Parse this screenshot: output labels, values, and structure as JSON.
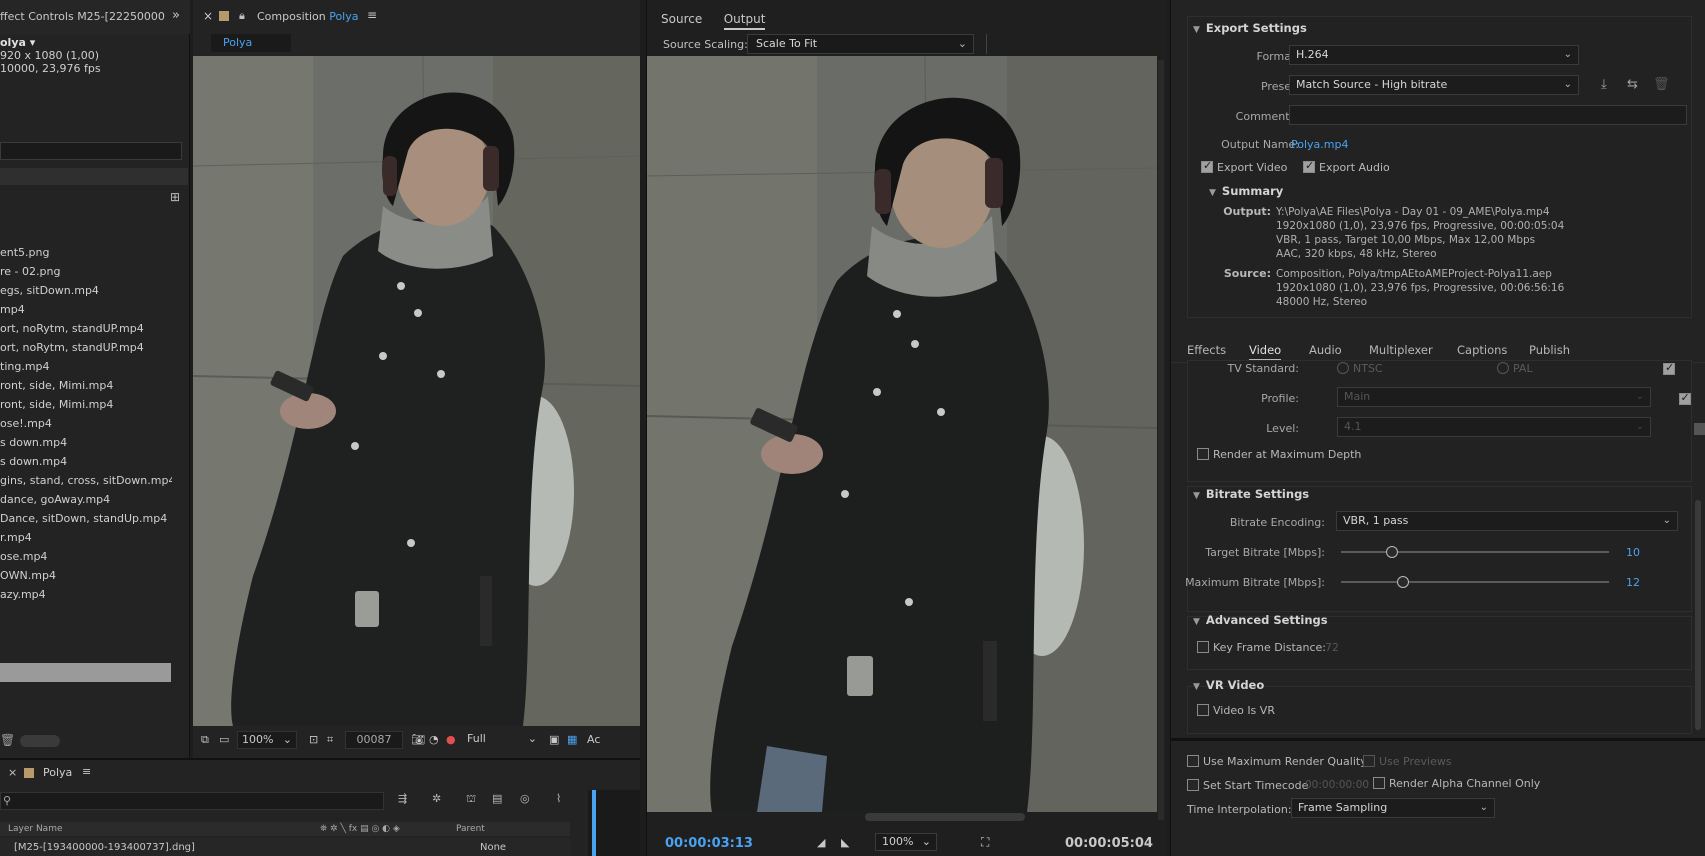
{
  "project": {
    "tab_title": "ffect Controls M25-[22250000",
    "comp_name": "olya ▾",
    "comp_res": "920 x 1080 (1,00)",
    "comp_frames": "10000, 23,976 fps",
    "files": [
      "ent5.png",
      "re - 02.png",
      "egs, sitDown.mp4",
      "mp4",
      "ort, noRytm, standUP.mp4",
      "ort, noRytm, standUP.mp4",
      "ting.mp4",
      "ront, side, Mimi.mp4",
      "ront, side, Mimi.mp4",
      "ose!.mp4",
      "s down.mp4",
      "s down.mp4",
      "gins, stand, cross, sitDown.mp4",
      "dance, goAway.mp4",
      "Dance, sitDown, standUp.mp4",
      "r.mp4",
      "ose.mp4",
      "OWN.mp4",
      "azy.mp4"
    ]
  },
  "composition": {
    "tab_prefix": "Composition",
    "tab_name": "Polya",
    "subtab": "Polya",
    "zoom": "100%",
    "frame": "00087",
    "resolution": "Full",
    "trailing": "Ac"
  },
  "timeline": {
    "comp_tab": "Polya",
    "col_layer": "Layer Name",
    "col_parent": "Parent",
    "row1_name": "[M25-[193400000-193400737].dng]",
    "row1_parent": "None"
  },
  "output_panel": {
    "tabs": [
      "Source",
      "Output"
    ],
    "active_tab": "Output",
    "scaling_label": "Source Scaling:",
    "scaling_value": "Scale To Fit",
    "current_time": "00:00:03:13",
    "duration": "00:00:05:04",
    "zoom": "100%"
  },
  "export_settings": {
    "title": "Export Settings",
    "format_label": "Format:",
    "format_value": "H.264",
    "preset_label": "Preset:",
    "preset_value": "Match Source - High bitrate",
    "comments_label": "Comments:",
    "output_name_label": "Output Name:",
    "output_name_value": "Polya.mp4",
    "export_video": "Export Video",
    "export_audio": "Export Audio",
    "summary_title": "Summary",
    "output_key": "Output:",
    "output_lines": [
      "Y:\\Polya\\AE Files\\Polya - Day 01 - 09_AME\\Polya.mp4",
      "1920x1080 (1,0), 23,976 fps, Progressive, 00:00:05:04",
      "VBR, 1 pass, Target 10,00 Mbps, Max 12,00 Mbps",
      "AAC, 320 kbps, 48 kHz, Stereo"
    ],
    "source_key": "Source:",
    "source_lines": [
      "Composition, Polya/tmpAEtoAMEProject-Polya11.aep",
      "1920x1080 (1,0), 23,976 fps, Progressive, 00:06:56:16",
      "48000 Hz, Stereo"
    ]
  },
  "settings_tabs": [
    "Effects",
    "Video",
    "Audio",
    "Multiplexer",
    "Captions",
    "Publish"
  ],
  "settings_active_tab": "Video",
  "video": {
    "tv_standard_label": "TV Standard:",
    "ntsc": "NTSC",
    "pal": "PAL",
    "profile_label": "Profile:",
    "profile_value": "Main",
    "level_label": "Level:",
    "level_value": "4.1",
    "render_max_depth": "Render at Maximum Depth"
  },
  "bitrate": {
    "title": "Bitrate Settings",
    "encoding_label": "Bitrate Encoding:",
    "encoding_value": "VBR, 1 pass",
    "target_label": "Target Bitrate [Mbps]:",
    "target_value": "10",
    "target_fraction": 0.19,
    "max_label": "Maximum Bitrate [Mbps]:",
    "max_value": "12",
    "max_fraction": 0.23
  },
  "advanced": {
    "title": "Advanced Settings",
    "keyframe_label": "Key Frame Distance:",
    "keyframe_value": "72"
  },
  "vr": {
    "title": "VR Video",
    "video_is_vr": "Video Is VR"
  },
  "bottom_options": {
    "max_render_quality": "Use Maximum Render Quality",
    "use_previews": "Use Previews",
    "set_start_timecode": "Set Start Timecode",
    "start_timecode_value": "00:00:00:00",
    "render_alpha": "Render Alpha Channel Only",
    "time_interp_label": "Time Interpolation:",
    "time_interp_value": "Frame Sampling"
  }
}
